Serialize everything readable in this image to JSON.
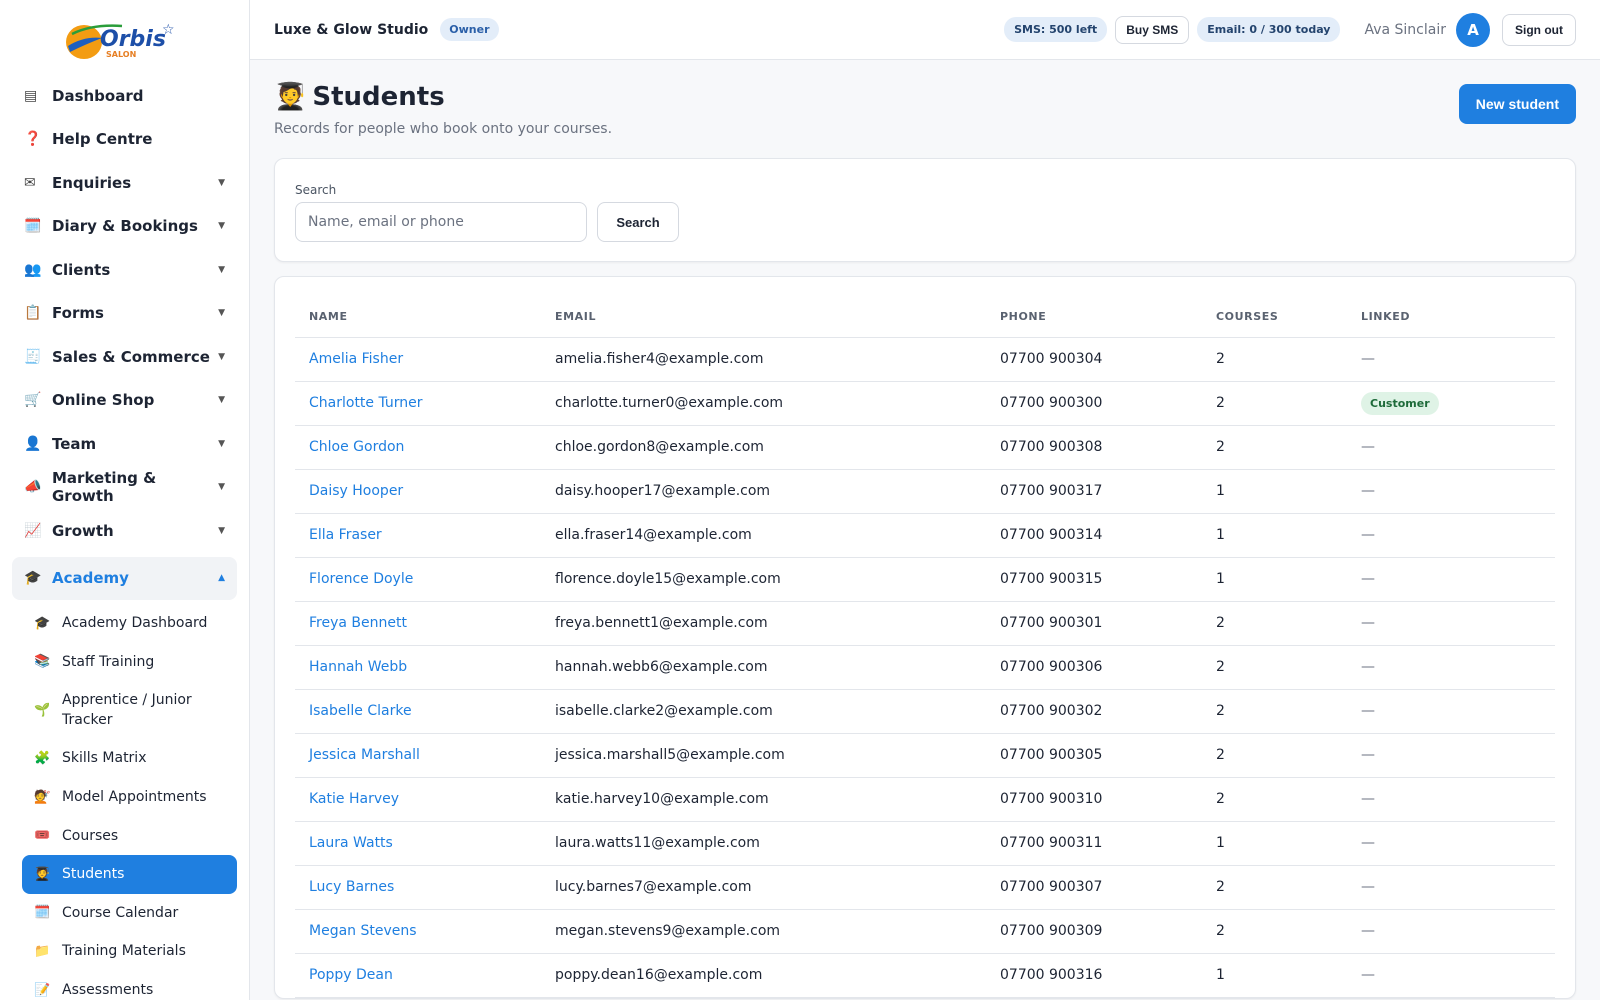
{
  "brand": {
    "logo_text": "Orbis",
    "logo_sub": "SALON"
  },
  "sidebar": {
    "items": [
      {
        "icon": "▤",
        "label": "Dashboard",
        "caret": ""
      },
      {
        "icon": "❓",
        "label": "Help Centre",
        "caret": ""
      },
      {
        "icon": "✉",
        "label": "Enquiries",
        "caret": "▼"
      },
      {
        "icon": "🗓️",
        "label": "Diary & Bookings",
        "caret": "▼"
      },
      {
        "icon": "👥",
        "label": "Clients",
        "caret": "▼"
      },
      {
        "icon": "📋",
        "label": "Forms",
        "caret": "▼"
      },
      {
        "icon": "🧾",
        "label": "Sales & Commerce",
        "caret": "▼"
      },
      {
        "icon": "🛒",
        "label": "Online Shop",
        "caret": "▼"
      },
      {
        "icon": "👤",
        "label": "Team",
        "caret": "▼"
      },
      {
        "icon": "📣",
        "label": "Marketing & Growth",
        "caret": "▼"
      },
      {
        "icon": "📈",
        "label": "Growth",
        "caret": "▼"
      }
    ],
    "academy": {
      "icon": "🎓",
      "label": "Academy",
      "caret": "▲"
    },
    "sub_items": [
      {
        "icon": "🎓",
        "label": "Academy Dashboard"
      },
      {
        "icon": "📚",
        "label": "Staff Training"
      },
      {
        "icon": "🌱",
        "label": "Apprentice / Junior Tracker"
      },
      {
        "icon": "🧩",
        "label": "Skills Matrix"
      },
      {
        "icon": "💇",
        "label": "Model Appointments"
      },
      {
        "icon": "🎟️",
        "label": "Courses"
      },
      {
        "icon": "🧑‍🎓",
        "label": "Students"
      },
      {
        "icon": "🗓️",
        "label": "Course Calendar"
      },
      {
        "icon": "📁",
        "label": "Training Materials"
      },
      {
        "icon": "📝",
        "label": "Assessments"
      }
    ],
    "active_sub": "Students"
  },
  "topbar": {
    "studio": "Luxe & Glow Studio",
    "role": "Owner",
    "sms": "SMS: 500 left",
    "buy_sms": "Buy SMS",
    "email": "Email: 0 / 300 today",
    "user": "Ava Sinclair",
    "avatar": "A",
    "sign_out": "Sign out"
  },
  "page": {
    "icon": "🧑‍🎓",
    "title": "Students",
    "subtitle": "Records for people who book onto your courses.",
    "new_button": "New student"
  },
  "search": {
    "label": "Search",
    "placeholder": "Name, email or phone",
    "value": "",
    "button": "Search"
  },
  "table": {
    "columns": [
      "NAME",
      "EMAIL",
      "PHONE",
      "COURSES",
      "LINKED"
    ],
    "rows": [
      {
        "name": "Amelia Fisher",
        "email": "amelia.fisher4@example.com",
        "phone": "07700 900304",
        "courses": "2",
        "linked": "—"
      },
      {
        "name": "Charlotte Turner",
        "email": "charlotte.turner0@example.com",
        "phone": "07700 900300",
        "courses": "2",
        "linked": "Customer"
      },
      {
        "name": "Chloe Gordon",
        "email": "chloe.gordon8@example.com",
        "phone": "07700 900308",
        "courses": "2",
        "linked": "—"
      },
      {
        "name": "Daisy Hooper",
        "email": "daisy.hooper17@example.com",
        "phone": "07700 900317",
        "courses": "1",
        "linked": "—"
      },
      {
        "name": "Ella Fraser",
        "email": "ella.fraser14@example.com",
        "phone": "07700 900314",
        "courses": "1",
        "linked": "—"
      },
      {
        "name": "Florence Doyle",
        "email": "florence.doyle15@example.com",
        "phone": "07700 900315",
        "courses": "1",
        "linked": "—"
      },
      {
        "name": "Freya Bennett",
        "email": "freya.bennett1@example.com",
        "phone": "07700 900301",
        "courses": "2",
        "linked": "—"
      },
      {
        "name": "Hannah Webb",
        "email": "hannah.webb6@example.com",
        "phone": "07700 900306",
        "courses": "2",
        "linked": "—"
      },
      {
        "name": "Isabelle Clarke",
        "email": "isabelle.clarke2@example.com",
        "phone": "07700 900302",
        "courses": "2",
        "linked": "—"
      },
      {
        "name": "Jessica Marshall",
        "email": "jessica.marshall5@example.com",
        "phone": "07700 900305",
        "courses": "2",
        "linked": "—"
      },
      {
        "name": "Katie Harvey",
        "email": "katie.harvey10@example.com",
        "phone": "07700 900310",
        "courses": "2",
        "linked": "—"
      },
      {
        "name": "Laura Watts",
        "email": "laura.watts11@example.com",
        "phone": "07700 900311",
        "courses": "1",
        "linked": "—"
      },
      {
        "name": "Lucy Barnes",
        "email": "lucy.barnes7@example.com",
        "phone": "07700 900307",
        "courses": "2",
        "linked": "—"
      },
      {
        "name": "Megan Stevens",
        "email": "megan.stevens9@example.com",
        "phone": "07700 900309",
        "courses": "2",
        "linked": "—"
      },
      {
        "name": "Poppy Dean",
        "email": "poppy.dean16@example.com",
        "phone": "07700 900316",
        "courses": "1",
        "linked": "—"
      }
    ]
  },
  "colors": {
    "accent": "#1f7fe0",
    "badge_bg": "#dff3e6",
    "badge_text": "#1e6b3a"
  }
}
